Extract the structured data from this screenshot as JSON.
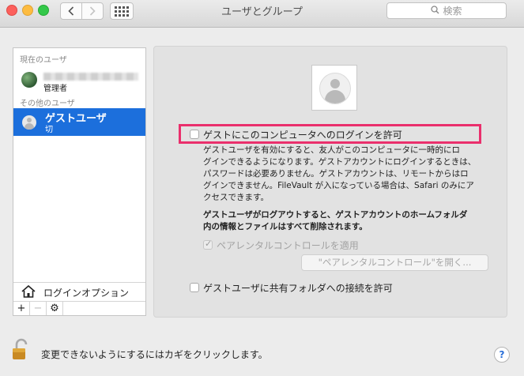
{
  "window": {
    "title": "ユーザとグループ",
    "search_placeholder": "検索"
  },
  "sidebar": {
    "current_users_header": "現在のユーザ",
    "current_user": {
      "role": "管理者"
    },
    "other_users_header": "その他のユーザ",
    "guest_user": {
      "name": "ゲストユーザ",
      "status": "切"
    },
    "login_options_label": "ログインオプション",
    "tools": [
      "+",
      "−",
      "⚙"
    ]
  },
  "panel": {
    "allow_guest_login_label": "ゲストにこのコンピュータへのログインを許可",
    "allow_guest_login_checked": false,
    "description_lines": [
      "ゲストユーザを有効にすると、友人がこのコンピュータに一時的にロ",
      "グインできるようになります。ゲストアカウントにログインするときは、",
      "パスワードは必要ありません。ゲストアカウントは、リモートからはロ",
      "グインできません。FileVault が入になっている場合は、Safari のみにア",
      "クセスできます。"
    ],
    "logout_note_lines": [
      "ゲストユーザがログアウトすると、ゲストアカウントのホームフォルダ",
      "内の情報とファイルはすべて削除されます。"
    ],
    "parental_controls_label": "ペアレンタルコントロールを適用",
    "parental_controls_checked": true,
    "open_parental_controls_button": "\"ペアレンタルコントロール\"を開く...",
    "shared_folders_label": "ゲストユーザに共有フォルダへの接続を許可",
    "shared_folders_checked": false
  },
  "footer": {
    "lock_text": "変更できないようにするにはカギをクリックします。",
    "help_label": "?"
  },
  "colors": {
    "selection": "#1c6fdc",
    "highlight_border": "#ea2f6c"
  }
}
